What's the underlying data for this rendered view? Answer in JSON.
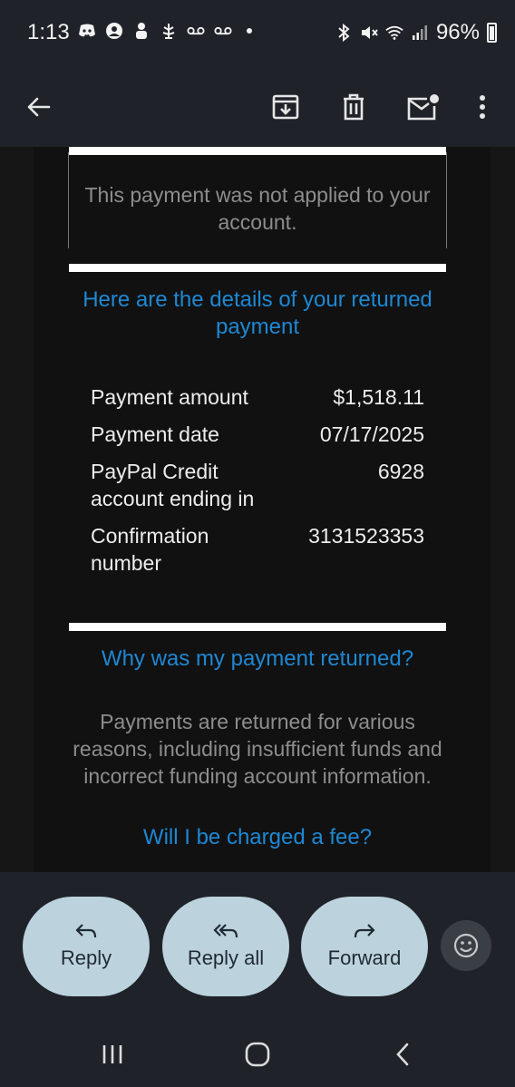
{
  "status_bar": {
    "time": "1:13",
    "battery_percent": "96%",
    "icons_left": [
      "discord-icon",
      "account-icon",
      "game-icon",
      "garden-icon",
      "voicemail-icon",
      "voicemail-icon",
      "notification-dot"
    ],
    "icons_right": [
      "bluetooth-icon",
      "mute-icon",
      "wifi-icon",
      "signal-icon",
      "battery-icon"
    ]
  },
  "app_bar": {
    "icons": [
      "back-arrow-icon",
      "archive-icon",
      "trash-icon",
      "mark-unread-icon",
      "more-vert-icon"
    ]
  },
  "email": {
    "notice": "This payment was not applied to your account.",
    "details_heading": "Here are the details of your returned payment",
    "details": [
      {
        "label": "Payment amount",
        "value": "$1,518.11"
      },
      {
        "label": "Payment date",
        "value": "07/17/2025"
      },
      {
        "label": "PayPal Credit account ending in",
        "value": "6928"
      },
      {
        "label": "Confirmation number",
        "value": "3131523353"
      }
    ],
    "why_heading": "Why was my payment returned?",
    "why_body": "Payments are returned for various reasons, including insufficient funds and incorrect funding account information.",
    "fee_heading": "Will I be charged a fee?"
  },
  "actions": {
    "reply_label": "Reply",
    "reply_all_label": "Reply all",
    "forward_label": "Forward"
  },
  "colors": {
    "link_blue": "#1e88d4",
    "pill_bg": "#bcd3de",
    "chrome_bg": "#1f2329"
  }
}
